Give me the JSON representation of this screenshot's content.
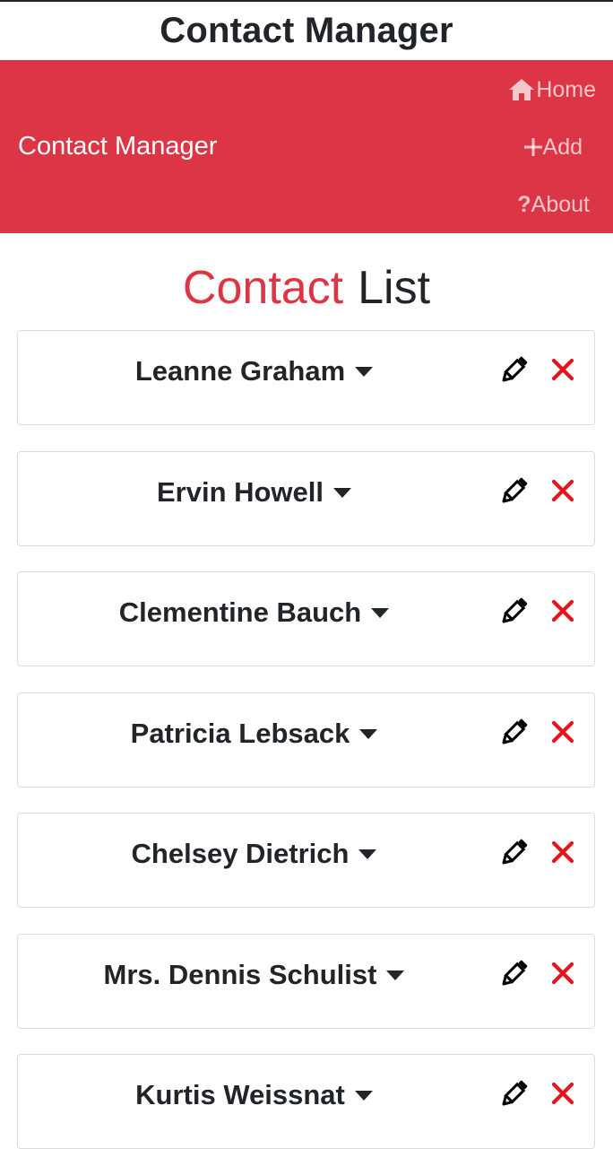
{
  "app": {
    "title": "Contact Manager"
  },
  "navbar": {
    "brand": "Contact Manager",
    "background_color": "#dc3545",
    "links": [
      {
        "icon": "home-icon",
        "label": "Home"
      },
      {
        "icon": "plus-icon",
        "label": "Add"
      },
      {
        "icon": "question-icon",
        "label": "About"
      }
    ]
  },
  "page": {
    "heading_accent": "Contact",
    "heading_rest": "List"
  },
  "contacts": [
    {
      "name": "Leanne Graham"
    },
    {
      "name": "Ervin Howell"
    },
    {
      "name": "Clementine Bauch"
    },
    {
      "name": "Patricia Lebsack"
    },
    {
      "name": "Chelsey Dietrich"
    },
    {
      "name": "Mrs. Dennis Schulist"
    },
    {
      "name": "Kurtis Weissnat"
    }
  ],
  "icons": {
    "expand": "caret-down-icon",
    "edit": "pencil-icon",
    "delete": "times-icon"
  },
  "colors": {
    "accent": "#dc3545",
    "delete": "#e5141d",
    "text": "#212529"
  }
}
